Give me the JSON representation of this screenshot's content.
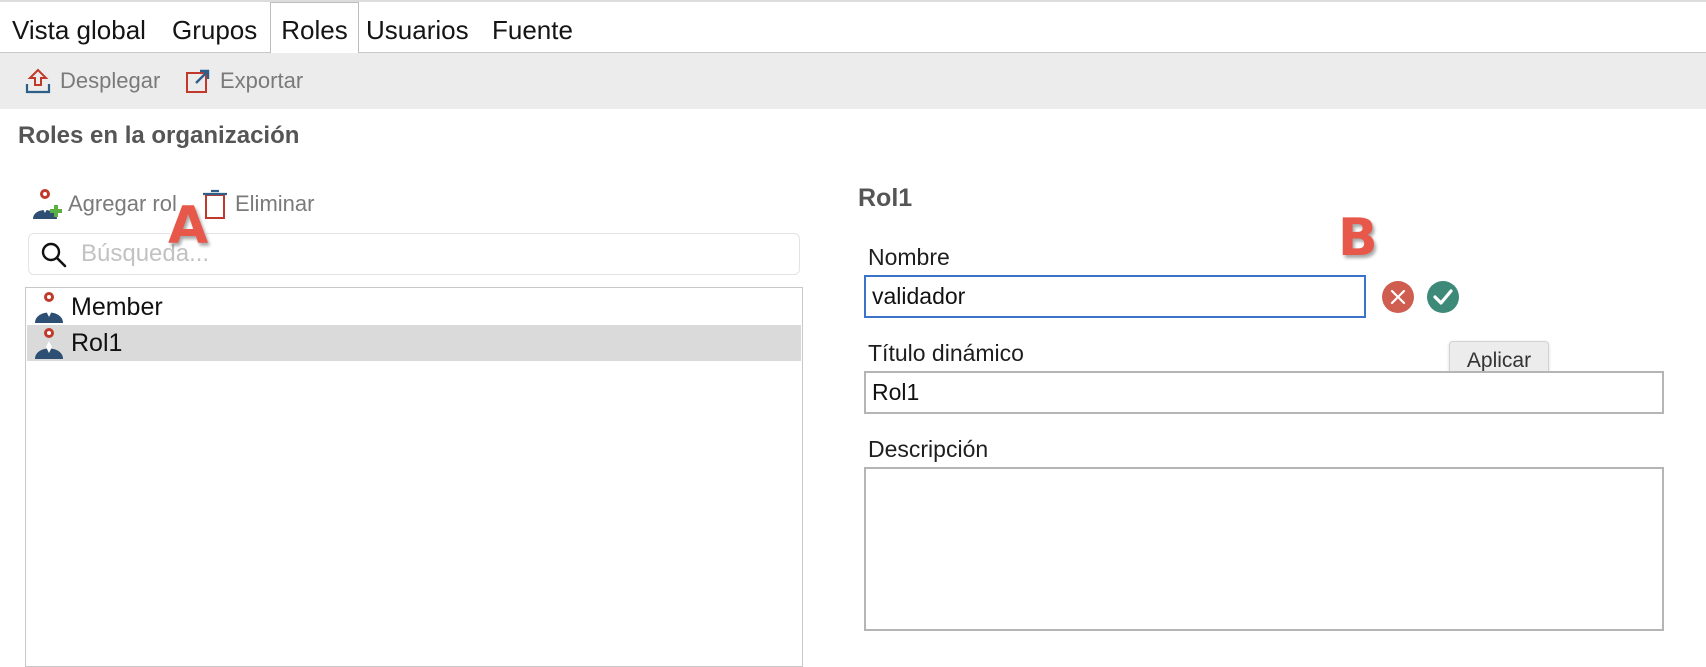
{
  "tabs": [
    {
      "label": "Vista global",
      "active": false
    },
    {
      "label": "Grupos",
      "active": false
    },
    {
      "label": "Roles",
      "active": true
    },
    {
      "label": "Usuarios",
      "active": false
    },
    {
      "label": "Fuente",
      "active": false
    }
  ],
  "toolbar": {
    "deploy_label": "Desplegar",
    "deploy_icon": "deploy-icon",
    "export_label": "Exportar",
    "export_icon": "export-icon"
  },
  "roles_panel": {
    "title": "Roles en la organización",
    "add_role_label": "Agregar rol",
    "delete_label": "Eliminar",
    "search_placeholder": "Búsqueda...",
    "search_icon": "search-icon",
    "roles": [
      {
        "name": "Member",
        "selected": false,
        "icon": "role-icon"
      },
      {
        "name": "Rol1",
        "selected": true,
        "icon": "role-icon"
      }
    ]
  },
  "detail": {
    "title": "Rol1",
    "name_label": "Nombre",
    "name_value": "validador",
    "cancel_icon": "cancel-icon",
    "apply_icon": "apply-icon",
    "apply_tooltip": "Aplicar",
    "dynamic_title_label": "Título dinámico",
    "dynamic_title_value": "Rol1",
    "description_label": "Descripción",
    "description_value": ""
  },
  "annotations": {
    "marker_a": "A",
    "marker_b": "B"
  },
  "colors": {
    "accent_blue": "#3a73c8",
    "cancel_red": "#cf5d50",
    "apply_green": "#3d8a78",
    "marker_red": "#e8584a",
    "icon_red": "#c0392b"
  }
}
